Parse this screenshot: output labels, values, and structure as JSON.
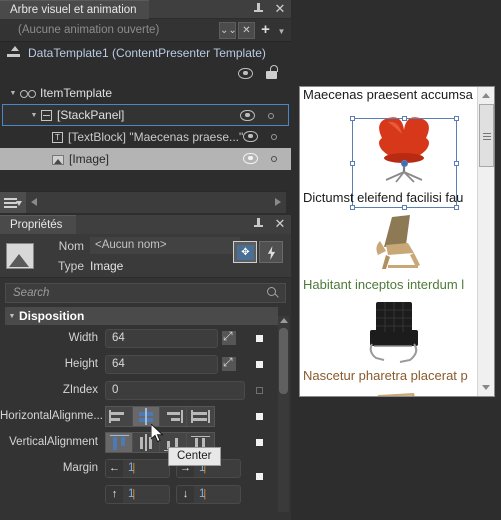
{
  "visual_tree_panel": {
    "tab_label": "Arbre visuel et animation",
    "pin_icon": "pin-icon",
    "close_icon": "close-icon",
    "animation_bar": {
      "current": "(Aucune animation ouverte)",
      "chevron_button": "chevron-down-icon",
      "close_button": "close-icon",
      "add_button": "+",
      "dropdown_button": "caret-down-icon"
    },
    "template_row": {
      "icon": "template-scope-icon",
      "label": "DataTemplate1 (ContentPresenter Template)"
    },
    "column_headers": {
      "visibility_icon": "eye-icon",
      "lock_icon": "unlock-icon"
    },
    "tree_nodes": [
      {
        "label": "ItemTemplate",
        "icon": "glasses-icon",
        "depth": 0,
        "twisty": "▼",
        "state": "normal",
        "has_eye": false,
        "has_dot": false
      },
      {
        "label": "[StackPanel]",
        "icon": "stackpanel-icon",
        "depth": 1,
        "twisty": "▼",
        "state": "selected",
        "has_eye": true,
        "has_dot": true
      },
      {
        "label": "[TextBlock] \"Maecenas praese...\"",
        "icon": "textblock-icon",
        "depth": 2,
        "twisty": "",
        "state": "normal",
        "has_eye": true,
        "has_dot": true
      },
      {
        "label": "[Image]",
        "icon": "image-icon",
        "depth": 2,
        "twisty": "",
        "state": "highlighted",
        "has_eye": true,
        "has_dot": true
      }
    ],
    "footer": {
      "layers_button": "layers-icon",
      "scroll_left": "◀",
      "scroll_right": "▶"
    }
  },
  "properties_panel": {
    "tab_label": "Propriétés",
    "pin_icon": "pin-icon",
    "close_icon": "close-icon",
    "name_label": "Nom",
    "name_value": "<Aucun nom>",
    "type_label": "Type",
    "type_value": "Image",
    "thumbnail_icon": "image-thumbnail",
    "header_buttons": [
      {
        "name": "properties-view-button",
        "icon": "arrows-icon",
        "active": true
      },
      {
        "name": "events-view-button",
        "icon": "lightning-icon",
        "active": false
      }
    ],
    "search_placeholder": "Search",
    "search_value": "",
    "search_icon": "search-icon",
    "sections": [
      {
        "title": "Disposition",
        "twisty": "▼",
        "rows": [
          {
            "label": "Width",
            "value": "64",
            "type": "text",
            "has_expand": true,
            "marker": "filled"
          },
          {
            "label": "Height",
            "value": "64",
            "type": "text",
            "has_expand": true,
            "marker": "filled"
          },
          {
            "label": "ZIndex",
            "value": "0",
            "type": "text-wide",
            "has_expand": false,
            "marker": "hollow"
          },
          {
            "label": "HorizontalAlignme...",
            "type": "align-h",
            "marker": "filled",
            "options": [
              "Left",
              "Center",
              "Right",
              "Stretch"
            ],
            "selected_index": 1
          },
          {
            "label": "VerticalAlignment",
            "type": "align-v",
            "marker": "filled",
            "options": [
              "Top",
              "Center",
              "Bottom",
              "Stretch"
            ],
            "selected_index": 0
          },
          {
            "label": "Margin",
            "type": "margin",
            "marker": "filled",
            "values": {
              "left": "1",
              "right": "1",
              "top": "1",
              "bottom": "1"
            },
            "arrows": {
              "left": "←",
              "right": "→",
              "top": "↑",
              "bottom": "↓"
            }
          }
        ]
      }
    ],
    "tooltip": "Center"
  },
  "preview": {
    "items": [
      {
        "text": "Maecenas praesent accumsa",
        "text_color": "#1a1a1a",
        "image": "red-swan-chair",
        "selected": true
      },
      {
        "text": "Dictumst eleifend facilisi fau",
        "text_color": "#1a1a1a",
        "image": "wood-lounge-chair",
        "selected": false
      },
      {
        "text": "Habitant inceptos interdum l",
        "text_color": "#4d7a3a",
        "image": "black-barcelona-chair",
        "selected": false
      },
      {
        "text": "Nascetur pharetra placerat p",
        "text_color": "#8a5a2b",
        "image": "tan-folding-chair",
        "selected": false
      }
    ],
    "scrollbar": {
      "up_arrow": "▲",
      "down_arrow": "▼"
    }
  },
  "colors": {
    "panel_bg": "#2d2d2d",
    "panel_alt": "#333333",
    "tab_bg": "#4a4a4a",
    "selection_blue": "#4a86c8",
    "highlight_row": "#b4b4b4",
    "accent_blue": "#4d79b5",
    "link_text": "#b8cce4",
    "margin_value": "#7fb2e6"
  }
}
